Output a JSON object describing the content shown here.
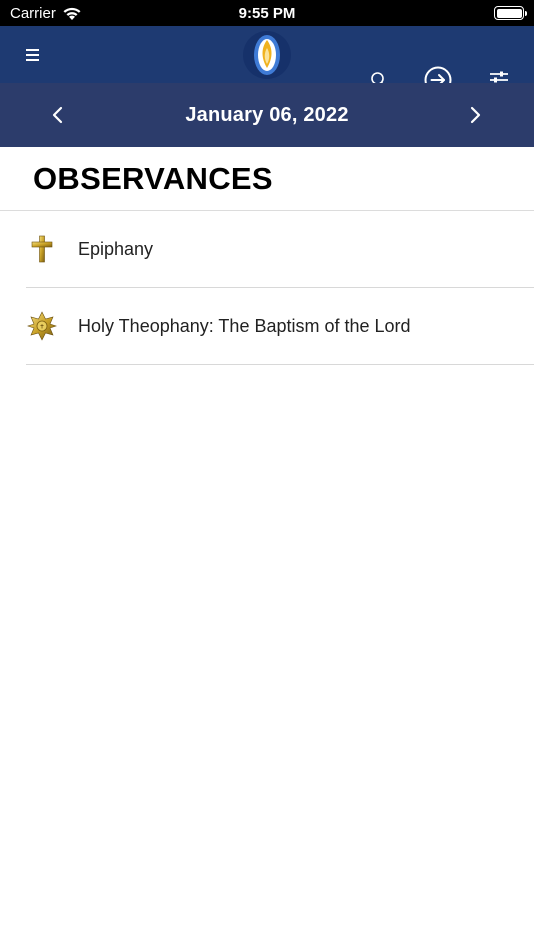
{
  "status_bar": {
    "carrier": "Carrier",
    "time": "9:55 PM"
  },
  "nav": {
    "menu_icon": "hamburger-menu-icon",
    "logo_icon": "flame-logo-icon",
    "search_icon": "search-icon",
    "login_icon": "arrow-right-circle-icon",
    "filter_icon": "sliders-icon"
  },
  "date_bar": {
    "date": "January 06, 2022",
    "prev_icon": "chevron-left-icon",
    "next_icon": "chevron-right-icon"
  },
  "section": {
    "title": "OBSERVANCES"
  },
  "observances": [
    {
      "label": "Epiphany",
      "icon": "cross-icon"
    },
    {
      "label": "Holy Theophany: The Baptism of the Lord",
      "icon": "star-emblem-icon"
    }
  ],
  "colors": {
    "nav_background": "#1e3a72",
    "date_bar_background": "#2c3c6b",
    "gold": "#c9a227"
  }
}
